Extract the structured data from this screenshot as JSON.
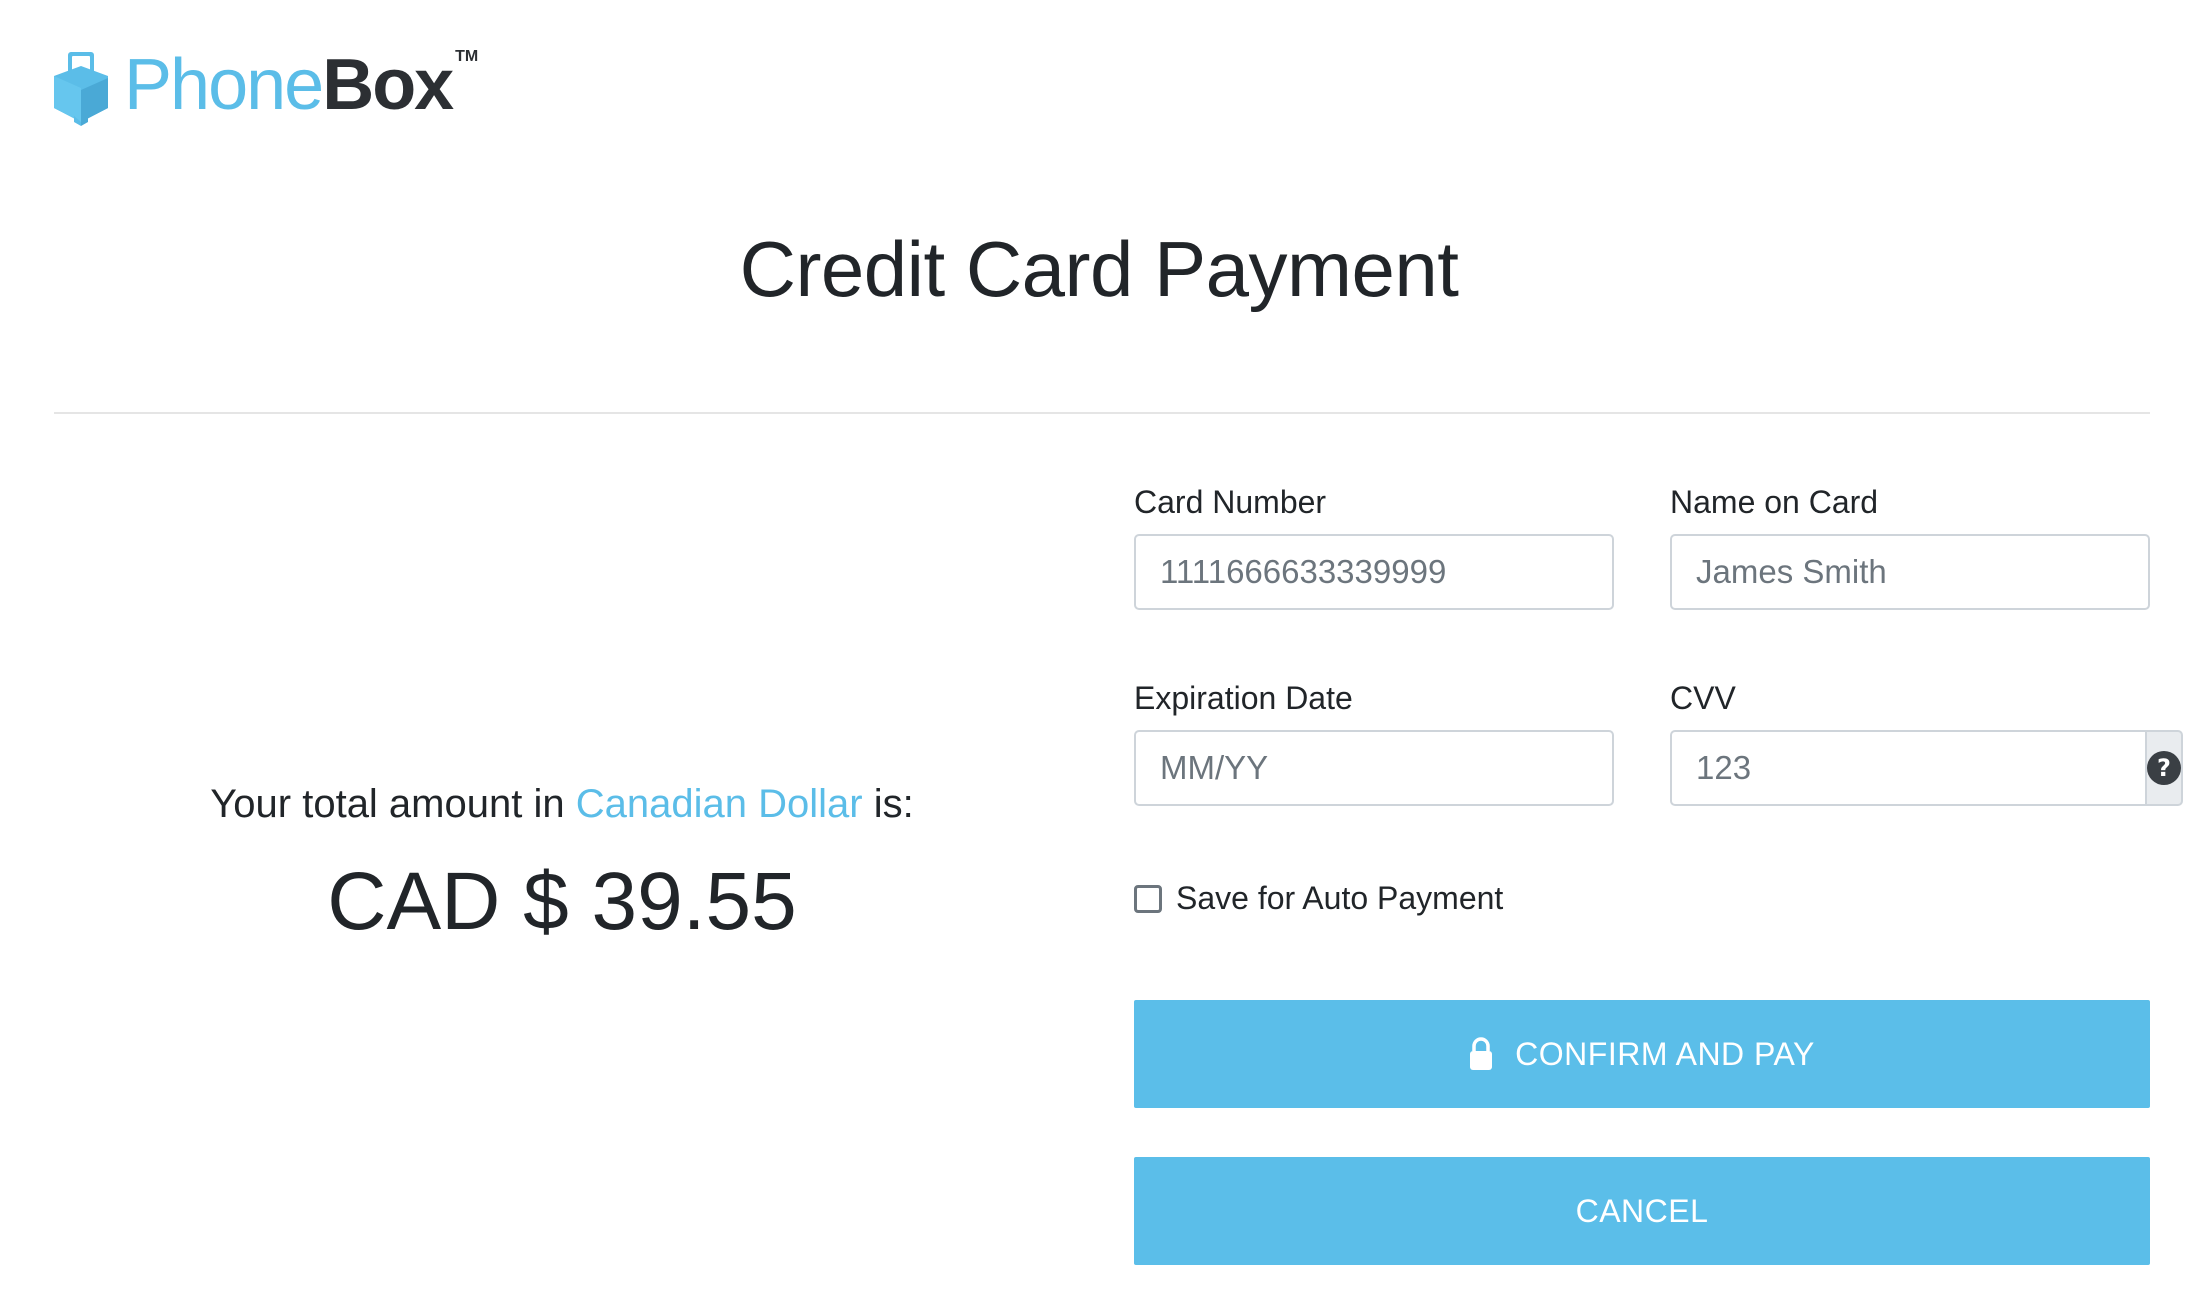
{
  "brand": {
    "name_part1": "Phone",
    "name_part2": "Box",
    "trademark": "TM",
    "logo_icon": "phone-box-logo-icon",
    "color_primary": "#5bbde8",
    "color_dark": "#2c2f33"
  },
  "page": {
    "title": "Credit Card Payment"
  },
  "summary": {
    "prefix": "Your total amount in",
    "currency_name": "Canadian Dollar",
    "suffix": "is:",
    "amount": "CAD $ 39.55"
  },
  "form": {
    "card_number": {
      "label": "Card Number",
      "placeholder": "1111666633339999",
      "value": ""
    },
    "name_on_card": {
      "label": "Name on Card",
      "placeholder": "James Smith",
      "value": ""
    },
    "expiration_date": {
      "label": "Expiration Date",
      "placeholder": "MM/YY",
      "value": ""
    },
    "cvv": {
      "label": "CVV",
      "placeholder": "123",
      "value": "",
      "help_icon": "question-circle-icon",
      "help_glyph": "?"
    },
    "auto_payment": {
      "label": "Save for Auto Payment",
      "checked": false
    }
  },
  "actions": {
    "confirm_label": "CONFIRM AND PAY",
    "confirm_icon": "lock-icon",
    "cancel_label": "CANCEL",
    "button_color": "#5bbee9"
  }
}
